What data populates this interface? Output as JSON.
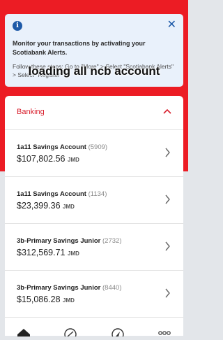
{
  "alert": {
    "icon": "info-icon",
    "message": "Monitor your transactions by activating your Scotiabank Alerts.",
    "steps": "Follow these steps: Go to \"More\" > Select \"Scotiabank Alerts\" > Select \"Register\"",
    "close_symbol": "✕"
  },
  "overlay_caption": "loading all ncb account",
  "banking": {
    "title": "Banking",
    "accounts": [
      {
        "name": "1a11 Savings Account",
        "number": "(5909)",
        "balance": "$107,802.56",
        "currency": "JMD"
      },
      {
        "name": "1a11 Savings Account",
        "number": "(1134)",
        "balance": "$23,399.36",
        "currency": "JMD"
      },
      {
        "name": "3b-Primary Savings Junior",
        "number": "(2732)",
        "balance": "$312,569.71",
        "currency": "JMD"
      },
      {
        "name": "3b-Primary Savings Junior",
        "number": "(8440)",
        "balance": "$15,086.28",
        "currency": "JMD"
      }
    ]
  },
  "nav": [
    "home-icon",
    "transfer-icon",
    "compass-icon",
    "more-icon"
  ],
  "colors": {
    "brand_red": "#ec1c24",
    "banking_title": "#d81e2c",
    "alert_bg": "#e9f1fb",
    "info_blue": "#1e5aa8"
  }
}
